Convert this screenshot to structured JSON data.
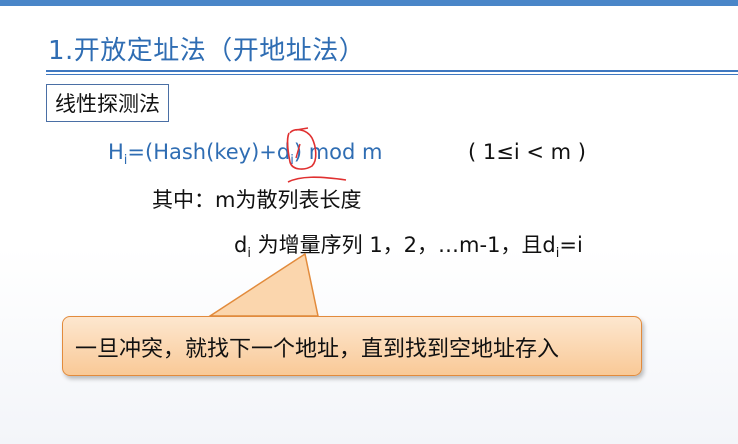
{
  "slide": {
    "title": "1.开放定址法（开地址法）",
    "section_label": "线性探测法",
    "formula": {
      "h": "H",
      "h_sub": "i",
      "mid": "=(Hash(key)+d",
      "d_sub": "i",
      "end": ") mod m",
      "range": "( 1≤i < m )"
    },
    "line2": "其中：m为散列表长度",
    "line3": {
      "d": "d",
      "d_sub": "i",
      "text": " 为增量序列 1，2，…m-1，且d",
      "d2_sub": "i",
      "end": "=i"
    },
    "callout": "一旦冲突，就找下一个地址，直到找到空地址存入"
  },
  "colors": {
    "accent": "#2f6db3",
    "callout_fill": "#f9c997",
    "callout_border": "#e28b3c",
    "annotation": "#e03030"
  }
}
